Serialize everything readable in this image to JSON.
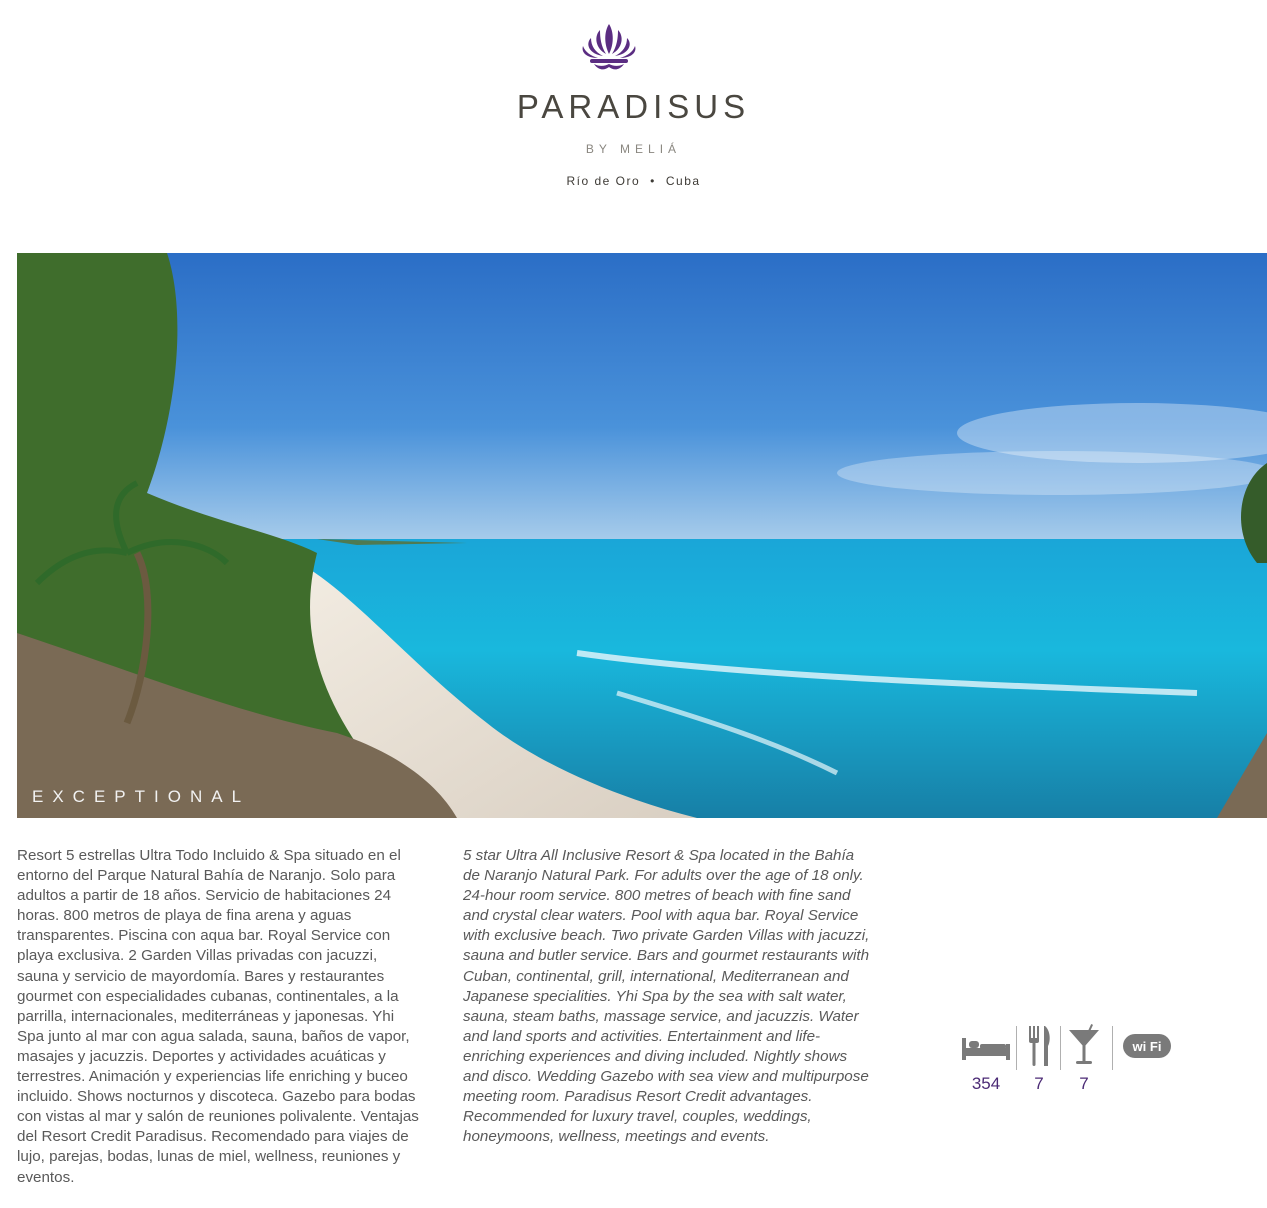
{
  "header": {
    "brand": "PARADISUS",
    "subtitle": "BY MELIÁ",
    "location_city": "Río de Oro",
    "location_sep": "•",
    "location_country": "Cuba"
  },
  "colors": {
    "brand_purple": "#5b2d82",
    "text_gray": "#595959",
    "number_purple": "#4b2a75"
  },
  "photo": {
    "caption": "EXCEPTIONAL"
  },
  "description_es": "Resort 5 estrellas Ultra Todo Incluido & Spa situado en el entorno del Parque Natural Bahía de Naranjo. Solo para adultos a partir de 18 años. Servicio de habitaciones 24 horas. 800 metros de playa de fina arena y aguas transparentes. Piscina con aqua bar. Royal Service con playa exclusiva. 2 Garden Villas privadas con jacuzzi, sauna y servicio de mayordomía. Bares y restaurantes gourmet con especialidades cubanas, continentales, a la parrilla, internacionales, mediterráneas y japonesas. Yhi Spa junto al mar con agua salada, sauna, baños de vapor, masajes y jacuzzis. Deportes y actividades acuáticas y terrestres. Animación y experiencias life enriching y buceo incluido. Shows nocturnos y discoteca. Gazebo para bodas con vistas al mar y salón de reuniones polivalente. Ventajas del Resort Credit Paradisus. Recomendado para viajes de lujo, parejas, bodas, lunas de miel, wellness, reuniones y eventos.",
  "description_en": "5 star Ultra All Inclusive Resort & Spa located in the Bahía de Naranjo Natural Park. For adults over the age of 18 only. 24-hour room service. 800 metres of beach with fine sand and crystal clear waters. Pool with aqua bar. Royal Service with exclusive beach. Two private Garden Villas with jacuzzi, sauna and butler service. Bars and gourmet restaurants with Cuban, continental, grill, international, Mediterranean and Japanese specialities. Yhi Spa by the sea with salt water, sauna, steam baths, massage service, and jacuzzis. Water and land sports and activities. Entertainment and life-enriching experiences and diving included. Nightly shows and disco. Wedding Gazebo with sea view and multipurpose meeting room. Paradisus Resort Credit advantages. Recommended for luxury travel, couples, weddings, honeymoons, wellness, meetings and events.",
  "amenities": [
    {
      "icon": "bed-icon",
      "value": "354"
    },
    {
      "icon": "restaurant-icon",
      "value": "7"
    },
    {
      "icon": "cocktail-icon",
      "value": "7"
    },
    {
      "icon": "wifi-icon",
      "label": "wi Fi"
    }
  ]
}
